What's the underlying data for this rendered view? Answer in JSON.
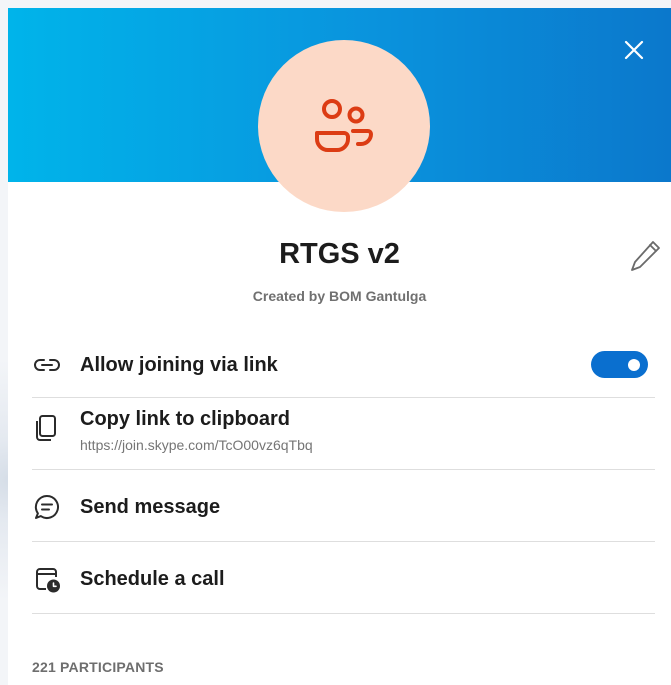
{
  "header": {
    "background_gradient": [
      "#00b4ea",
      "#0b78cc"
    ],
    "close_icon": "close-icon"
  },
  "group": {
    "avatar_icon": "group-people-icon",
    "avatar_bg": "#fcd9c7",
    "avatar_fg": "#dc3c14",
    "name": "RTGS v2",
    "created_by": "Created by BOM Gantulga",
    "edit_icon": "pencil-icon"
  },
  "actions": {
    "allow_joining": {
      "label": "Allow joining via link",
      "icon": "link-icon",
      "enabled": true
    },
    "copy_link": {
      "label": "Copy link to clipboard",
      "url": "https://join.skype.com/TcO00vz6qTbq",
      "icon": "copy-icon"
    },
    "send_message": {
      "label": "Send message",
      "icon": "chat-bubble-icon"
    },
    "schedule_call": {
      "label": "Schedule a call",
      "icon": "calendar-clock-icon"
    }
  },
  "participants": {
    "heading": "221 PARTICIPANTS"
  },
  "colors": {
    "accent": "#0a6fcf",
    "text": "#1c1c1c",
    "muted": "#707070"
  }
}
